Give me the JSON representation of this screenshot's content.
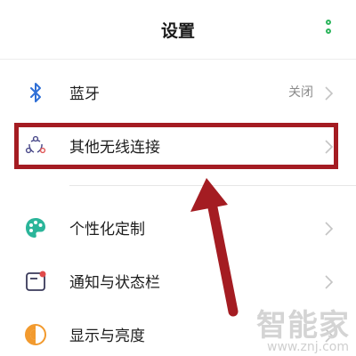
{
  "header": {
    "title": "设置",
    "more_icon": "more-vertical-icon"
  },
  "settings": [
    {
      "label": "蓝牙",
      "value": "关闭",
      "icon": "bluetooth-icon",
      "icon_color": "#2f6fd6"
    },
    {
      "label": "其他无线连接",
      "value": "",
      "icon": "share-connections-icon",
      "icon_color": "#4a4a8a"
    },
    {
      "label": "个性化定制",
      "value": "",
      "icon": "palette-icon",
      "icon_color": "#2bb59a"
    },
    {
      "label": "通知与状态栏",
      "value": "",
      "icon": "notification-icon",
      "icon_color": "#e04a4a"
    },
    {
      "label": "显示与亮度",
      "value": "",
      "icon": "brightness-icon",
      "icon_color": "#f29a2e"
    }
  ],
  "annotation": {
    "highlight_color": "#a41c22"
  },
  "watermark": {
    "text": "智能家",
    "url": "www.znj.com"
  },
  "colors": {
    "accent_green": "#2db55d",
    "chevron": "#c4c4c4"
  }
}
